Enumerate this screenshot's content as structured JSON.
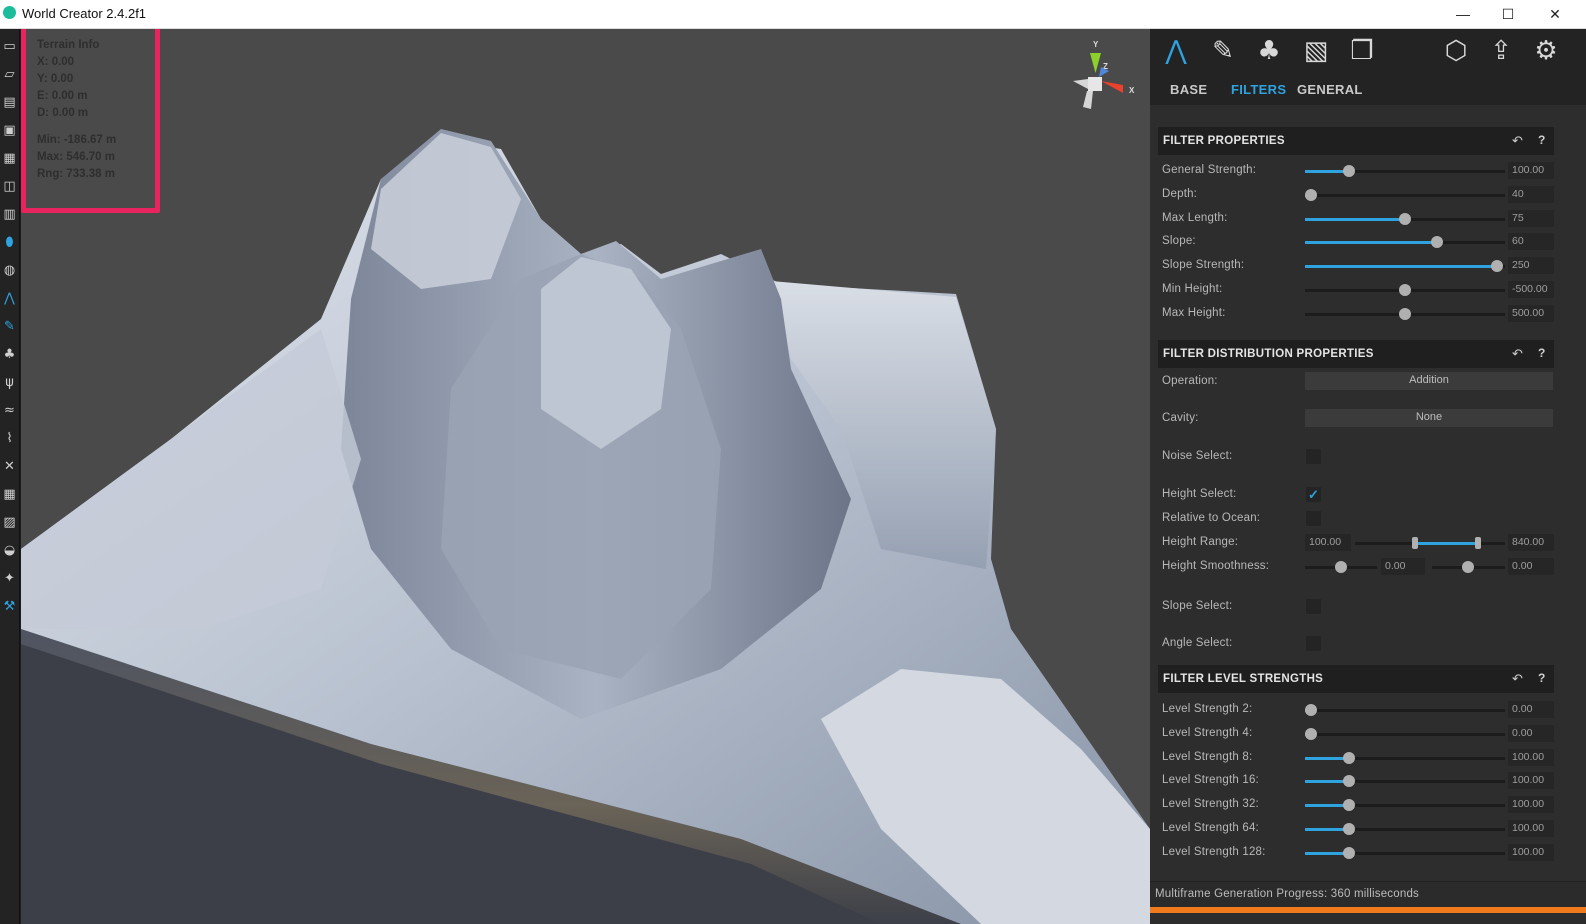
{
  "window": {
    "title": "World Creator 2.4.2f1",
    "minimize": "—",
    "maximize": "☐",
    "close": "✕"
  },
  "left_toolbar": {
    "icons": [
      "new-file-icon",
      "open-folder-icon",
      "open-recent-icon",
      "save-icon",
      "save-as-icon",
      "import-icon",
      "map-icon",
      "car-icon",
      "globe-icon",
      "terrain-icon",
      "brush-icon",
      "trees-icon",
      "grass-icon",
      "water-icon",
      "road-icon",
      "network-icon",
      "grid-icon",
      "image-icon",
      "color-icon",
      "star-icon",
      "tools-icon"
    ]
  },
  "viewport": {
    "terrain_info": {
      "heading": "Terrain Info",
      "x": "X: 0.00",
      "y": "Y: 0.00",
      "e": "E: 0.00 m",
      "d": "D: 0.00 m",
      "min": "Min: -186.67 m",
      "max": "Max: 546.70 m",
      "rng": "Rng: 733.38 m"
    },
    "gizmo": {
      "y": "Y",
      "z": "Z",
      "x": "X"
    }
  },
  "panel": {
    "top_icons": [
      "terrain-tab-icon",
      "brush-tool-icon",
      "trees-tab-icon",
      "map-tab-icon",
      "layers-tab-icon",
      "export-3d-icon",
      "share-icon",
      "settings-gear-icon"
    ],
    "tabs": [
      {
        "label": "BASE",
        "active": false
      },
      {
        "label": "FILTERS",
        "active": true
      },
      {
        "label": "GENERAL",
        "active": false
      }
    ],
    "filter_properties": {
      "title": "FILTER PROPERTIES",
      "reset": "↶",
      "help": "?",
      "rows": [
        {
          "label": "General Strength:",
          "value": "100.00",
          "level": 0.22
        },
        {
          "label": "Depth:",
          "value": "40",
          "level": 0.03
        },
        {
          "label": "Max Length:",
          "value": "75",
          "level": 0.5
        },
        {
          "label": "Slope:",
          "value": "60",
          "level": 0.66
        },
        {
          "label": "Slope Strength:",
          "value": "250",
          "level": 0.96
        },
        {
          "label": "Min Height:",
          "value": "-500.00",
          "level": 0.5,
          "unfilled": true
        },
        {
          "label": "Max Height:",
          "value": "500.00",
          "level": 0.5,
          "unfilled": true
        }
      ]
    },
    "distribution": {
      "title": "FILTER DISTRIBUTION PROPERTIES",
      "reset": "↶",
      "help": "?",
      "operation_label": "Operation:",
      "operation_value": "Addition",
      "cavity_label": "Cavity:",
      "cavity_value": "None",
      "noise_select_label": "Noise Select:",
      "noise_select_checked": false,
      "height_select_label": "Height Select:",
      "height_select_checked": true,
      "height_select_mark": "✓",
      "relative_ocean_label": "Relative to Ocean:",
      "relative_ocean_checked": false,
      "height_range_label": "Height Range:",
      "height_range_min": "100.00",
      "height_range_max": "840.00",
      "height_range_low": 0.4,
      "height_range_high": 0.82,
      "height_smoothness_label": "Height Smoothness:",
      "height_smoothness_a": "0.00",
      "height_smoothness_b": "0.00",
      "slope_select_label": "Slope Select:",
      "slope_select_checked": false,
      "angle_select_label": "Angle Select:",
      "angle_select_checked": false
    },
    "level_strengths": {
      "title": "FILTER LEVEL STRENGTHS",
      "reset": "↶",
      "help": "?",
      "rows": [
        {
          "label": "Level Strength 2:",
          "value": "0.00",
          "level": 0.03
        },
        {
          "label": "Level Strength 4:",
          "value": "0.00",
          "level": 0.03
        },
        {
          "label": "Level Strength 8:",
          "value": "100.00",
          "level": 0.22
        },
        {
          "label": "Level Strength 16:",
          "value": "100.00",
          "level": 0.22
        },
        {
          "label": "Level Strength 32:",
          "value": "100.00",
          "level": 0.22
        },
        {
          "label": "Level Strength 64:",
          "value": "100.00",
          "level": 0.22
        },
        {
          "label": "Level Strength 128:",
          "value": "100.00",
          "level": 0.22
        }
      ]
    },
    "status": "Multiframe Generation Progress: 360 milliseconds",
    "colors": {
      "accent": "#2ea3e0",
      "progress": "#f07a1c",
      "highlight": "#e8245e"
    }
  }
}
